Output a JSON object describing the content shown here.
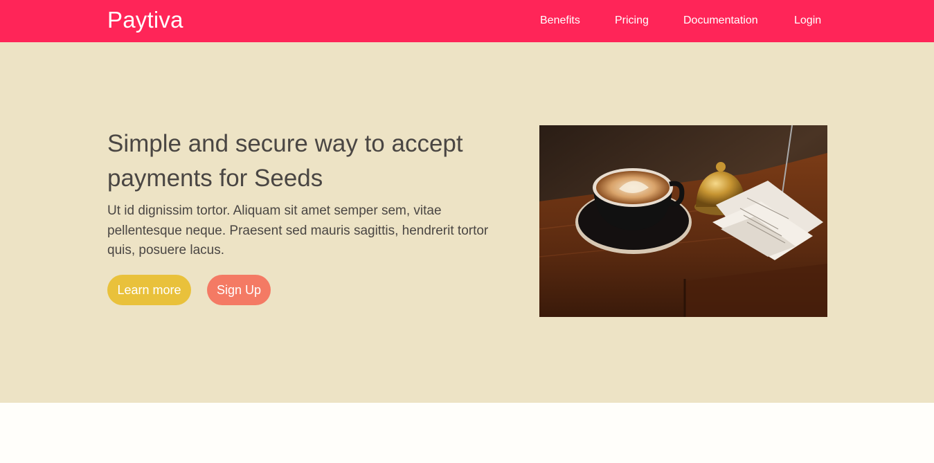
{
  "nav": {
    "brand": "Paytiva",
    "links": [
      {
        "label": "Benefits"
      },
      {
        "label": "Pricing"
      },
      {
        "label": "Documentation"
      },
      {
        "label": "Login"
      }
    ]
  },
  "hero": {
    "title": "Simple and secure way to accept payments for Seeds",
    "text": "Ut id dignissim tortor. Aliquam sit amet semper sem, vitae pellentesque neque. Praesent sed mauris sagittis, hendrerit tortor quis, posuere lacus.",
    "buttons": {
      "learn_more": "Learn more",
      "sign_up": "Sign Up"
    },
    "image_icon": "coffee-cup-receipts-photo"
  },
  "colors": {
    "navbar": "#ff2558",
    "hero_bg": "#ede3c5",
    "learn_more": "#e9c13b",
    "sign_up": "#f47a64",
    "text": "#4a4643"
  }
}
